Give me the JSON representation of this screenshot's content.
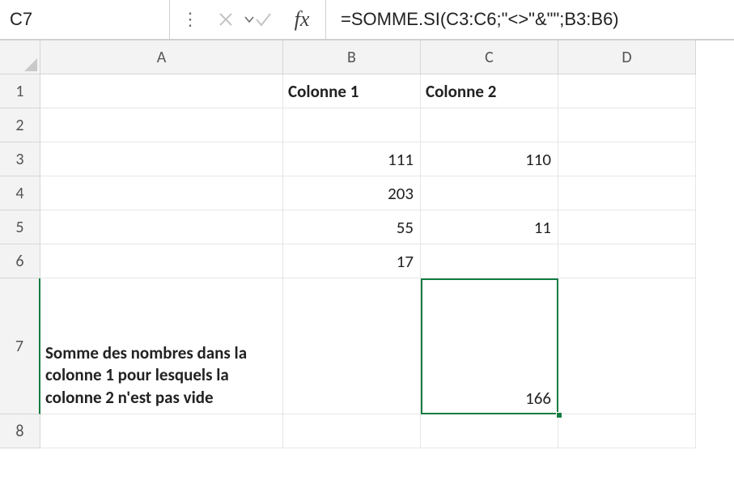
{
  "formula_bar": {
    "active_cell": "C7",
    "formula": "=SOMME.SI(C3:C6;\"<>\"&\"\";B3:B6)",
    "fx_label": "fx"
  },
  "columns": {
    "A": "A",
    "B": "B",
    "C": "C",
    "D": "D"
  },
  "rows": {
    "1": "1",
    "2": "2",
    "3": "3",
    "4": "4",
    "5": "5",
    "6": "6",
    "7": "7",
    "8": "8"
  },
  "cells": {
    "B1": "Colonne 1",
    "C1": "Colonne 2",
    "B3": "111",
    "C3": "110",
    "B4": "203",
    "B5": "55",
    "C5": "11",
    "B6": "17",
    "A7": "Somme des nombres dans la colonne 1 pour lesquels la colonne 2 n'est pas vide",
    "C7": "166"
  },
  "chart_data": {
    "type": "table",
    "headers": [
      "Colonne 1",
      "Colonne 2"
    ],
    "rows": [
      [
        111,
        110
      ],
      [
        203,
        null
      ],
      [
        55,
        11
      ],
      [
        17,
        null
      ]
    ],
    "computation": {
      "label": "Somme des nombres dans la colonne 1 pour lesquels la colonne 2 n'est pas vide",
      "formula": "=SOMME.SI(C3:C6;\"<>\"&\"\";B3:B6)",
      "result": 166
    }
  }
}
